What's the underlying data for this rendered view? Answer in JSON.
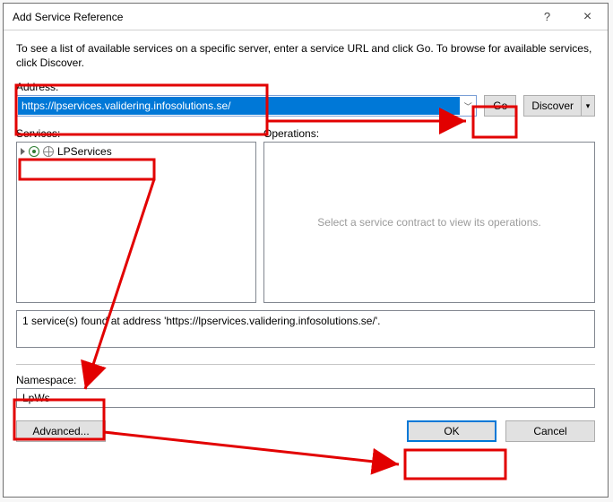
{
  "window": {
    "title": "Add Service Reference",
    "help": "?",
    "close": "×"
  },
  "intro": "To see a list of available services on a specific server, enter a service URL and click Go. To browse for available services, click Discover.",
  "address": {
    "label": "Address:",
    "value": "https://lpservices.validering.infosolutions.se/",
    "go": "Go",
    "discover": "Discover"
  },
  "services": {
    "label": "Services:",
    "items": [
      "LPServices"
    ]
  },
  "operations": {
    "label": "Operations:",
    "empty": "Select a service contract to view its operations."
  },
  "status": "1 service(s) found at address 'https://lpservices.validering.infosolutions.se/'.",
  "namespace": {
    "label": "Namespace:",
    "value": "LpWs"
  },
  "buttons": {
    "advanced": "Advanced...",
    "ok": "OK",
    "cancel": "Cancel"
  }
}
